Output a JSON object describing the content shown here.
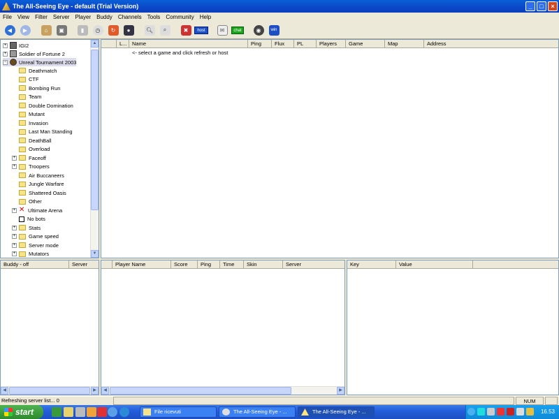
{
  "window": {
    "title": "The All-Seeing Eye - default (Trial Version)",
    "min": "_",
    "max": "□",
    "close": "×"
  },
  "menu": [
    "File",
    "View",
    "Filter",
    "Server",
    "Player",
    "Buddy",
    "Channels",
    "Tools",
    "Community",
    "Help"
  ],
  "toolbar": {
    "host_label": "host",
    "chat_label": "chat",
    "win_label": "win"
  },
  "tree": {
    "games": [
      "IGI2",
      "Soldier of Fortune 2",
      "Unreal Tournament 2003"
    ],
    "ut_children": [
      {
        "label": "Deathmatch",
        "expandable": false
      },
      {
        "label": "CTF",
        "expandable": false
      },
      {
        "label": "Bombing Run",
        "expandable": false
      },
      {
        "label": "Team",
        "expandable": false
      },
      {
        "label": "Double Domination",
        "expandable": false
      },
      {
        "label": "Mutant",
        "expandable": false
      },
      {
        "label": "Invasion",
        "expandable": false
      },
      {
        "label": "Last Man Standing",
        "expandable": false
      },
      {
        "label": "DeathBall",
        "expandable": false
      },
      {
        "label": "Overload",
        "expandable": false
      },
      {
        "label": "Faceoff",
        "expandable": true
      },
      {
        "label": "Troopers",
        "expandable": true
      },
      {
        "label": "Air Buccaneers",
        "expandable": false
      },
      {
        "label": "Jungle Warfare",
        "expandable": false
      },
      {
        "label": "Shattered Oasis",
        "expandable": false
      },
      {
        "label": "Other",
        "expandable": false
      },
      {
        "label": "Ultimate Arena",
        "expandable": true,
        "icon": "x"
      },
      {
        "label": "No bots",
        "expandable": false,
        "icon": "checkbox"
      },
      {
        "label": "Stats",
        "expandable": true
      },
      {
        "label": "Game speed",
        "expandable": true
      },
      {
        "label": "Server mode",
        "expandable": true
      },
      {
        "label": "Mutators",
        "expandable": true
      }
    ]
  },
  "server_list": {
    "columns": [
      "L...",
      "Name",
      "Ping",
      "Flux",
      "PL",
      "Players",
      "Game",
      "Map",
      "Address"
    ],
    "hint": "<- select a game and click refresh or host"
  },
  "buddy_panel": {
    "columns": [
      "Buddy - off",
      "Server"
    ]
  },
  "player_panel": {
    "columns": [
      "Player Name",
      "Score",
      "Ping",
      "Time",
      "Skin",
      "Server"
    ]
  },
  "rules_panel": {
    "columns": [
      "Key",
      "Value"
    ]
  },
  "status": {
    "text": "Refreshing server list... 0",
    "num": "NUM"
  },
  "taskbar": {
    "start": "start",
    "tasks": [
      "File ricevuti",
      "The All-Seeing Eye - ...",
      "The All-Seeing Eye - ..."
    ],
    "clock": "16.53"
  },
  "colors": {
    "titlebar": "#0b47c8",
    "taskbar": "#245edb",
    "start": "#3a9a3a"
  }
}
